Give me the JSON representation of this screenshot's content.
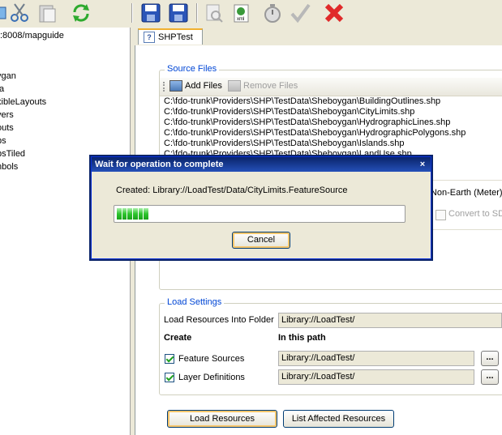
{
  "toolbar": {
    "buttons": [
      "tree-icon",
      "cut-icon",
      "paste-icon",
      "refresh-icon",
      "save-icon",
      "save-as-icon",
      "validate-icon",
      "xml-icon",
      "timer-icon",
      "check-icon",
      "delete-icon"
    ]
  },
  "tree": {
    "root": ":8008/mapguide",
    "items": [
      "ygan",
      "ta",
      "xibleLayouts",
      "yers",
      "outs",
      "ps",
      "psTiled",
      "nbols"
    ]
  },
  "tab": {
    "label": "SHPTest"
  },
  "source_files": {
    "title": "Source Files",
    "add_label": "Add Files",
    "remove_label": "Remove Files",
    "files": [
      "C:\\fdo-trunk\\Providers\\SHP\\TestData\\Sheboygan\\BuildingOutlines.shp",
      "C:\\fdo-trunk\\Providers\\SHP\\TestData\\Sheboygan\\CityLimits.shp",
      "C:\\fdo-trunk\\Providers\\SHP\\TestData\\Sheboygan\\HydrographicLines.shp",
      "C:\\fdo-trunk\\Providers\\SHP\\TestData\\Sheboygan\\HydrographicPolygons.shp",
      "C:\\fdo-trunk\\Providers\\SHP\\TestData\\Sheboygan\\Islands.shp",
      "C:\\fdo-trunk\\Providers\\SHP\\TestData\\Sheboygan\\LandUse.shp"
    ]
  },
  "coord": {
    "partial_text": "\"Non-Earth (Meter)",
    "convert_label": "Convert to SD"
  },
  "load_settings": {
    "title": "Load Settings",
    "folder_label": "Load Resources Into Folder",
    "folder_value": "Library://LoadTest/",
    "create_header": "Create",
    "path_header": "In this path",
    "rows": [
      {
        "label": "Feature Sources",
        "checked": true,
        "path": "Library://LoadTest/",
        "browse": "..."
      },
      {
        "label": "Layer Definitions",
        "checked": true,
        "path": "Library://LoadTest/",
        "browse": "..."
      }
    ]
  },
  "actions": {
    "load": "Load Resources",
    "list": "List Affected Resources"
  },
  "dialog": {
    "title": "Wait for operation to complete",
    "close": "×",
    "message": "Created: Library://LoadTest/Data/CityLimits.FeatureSource",
    "progress": 0.11,
    "cancel": "Cancel"
  }
}
